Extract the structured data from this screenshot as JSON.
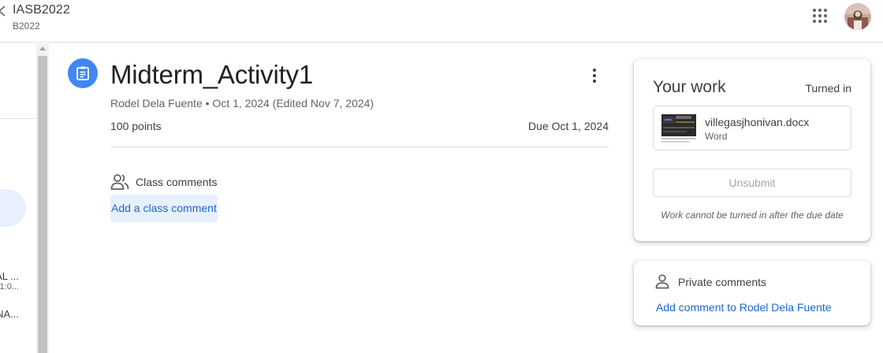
{
  "header": {
    "course_title": "IASB2022",
    "course_section": "B2022",
    "apps_icon": "grid-apps-icon",
    "avatar_icon": "user-avatar"
  },
  "sidebar": {
    "items": [
      {
        "label": "AL ...",
        "sub": "1:0..."
      },
      {
        "label": "NA..."
      }
    ]
  },
  "assignment": {
    "icon": "assignment-clipboard-icon",
    "title": "Midterm_Activity1",
    "meta": "Rodel Dela Fuente • Oct 1, 2024 (Edited Nov 7, 2024)",
    "points": "100 points",
    "due": "Due Oct 1, 2024",
    "accent_color": "#4285f4"
  },
  "class_comments": {
    "label": "Class comments",
    "add_label": "Add a class comment"
  },
  "your_work": {
    "title": "Your work",
    "status": "Turned in",
    "attachment": {
      "name": "villegasjhonivan.docx",
      "type": "Word"
    },
    "unsubmit_label": "Unsubmit",
    "note": "Work cannot be turned in after the due date"
  },
  "private_comments": {
    "label": "Private comments",
    "add_label": "Add comment to Rodel Dela Fuente"
  },
  "colors": {
    "link": "#1967d2",
    "highlight": "#e8f0fe"
  }
}
